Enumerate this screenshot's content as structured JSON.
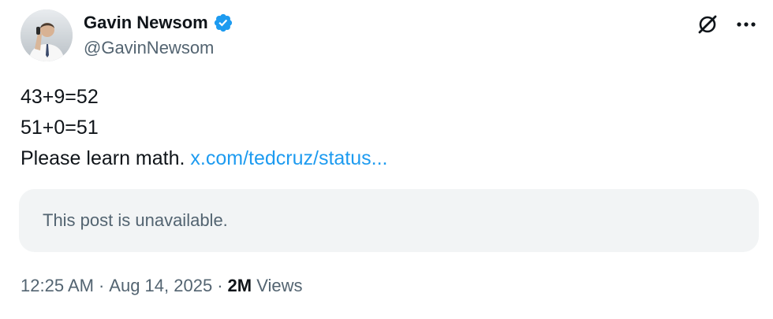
{
  "author": {
    "display_name": "Gavin Newsom",
    "handle": "@GavinNewsom",
    "verified": true,
    "verified_color": "#1d9bf0",
    "avatar_icon": "profile-photo"
  },
  "actions": {
    "grok_icon": "grok-icon",
    "more_icon": "more-horizontal-icon"
  },
  "post": {
    "lines": [
      "43+9=52",
      "51+0=51"
    ],
    "last_line_text": "Please learn math. ",
    "link_text": "x.com/tedcruz/status..."
  },
  "quote": {
    "text": "This post is unavailable."
  },
  "meta": {
    "time": "12:25 AM",
    "separator": "·",
    "date": "Aug 14, 2025",
    "views_count": "2M",
    "views_label": "Views"
  },
  "colors": {
    "link": "#1d9bf0",
    "secondary_text": "#536471",
    "primary_text": "#0f1419",
    "card_background": "#f2f4f5"
  }
}
